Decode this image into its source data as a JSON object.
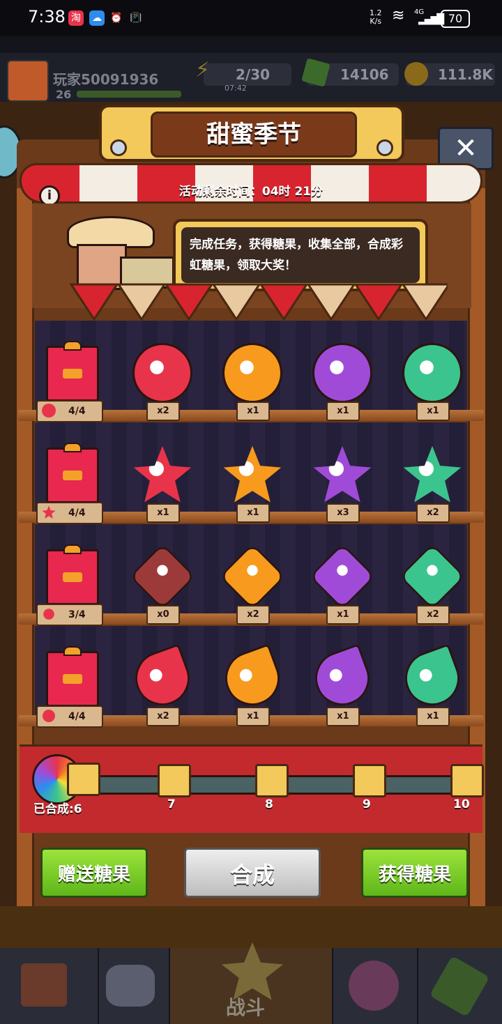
{
  "status_bar": {
    "time": "7:38",
    "app_icons": [
      "taobao-icon",
      "cloud-icon",
      "alarm-icon",
      "vibrate-icon"
    ],
    "net_speed_value": "1.2",
    "net_speed_unit": "K/s",
    "network_type": "4G",
    "battery": "70"
  },
  "game_header": {
    "player_name": "玩家50091936",
    "level": "26",
    "energy": "2/30",
    "energy_timer": "07:42",
    "gems": "14106",
    "coins": "111.8K"
  },
  "event": {
    "title": "甜蜜季节",
    "time_left": "活动剩余时间：04时 21分",
    "description": "完成任务，获得糖果，收集全部，合成彩虹糖果，领取大奖！"
  },
  "shelves": [
    {
      "shape": "round",
      "progress": "4/4",
      "candies": [
        {
          "color": "#e8344a",
          "count": "x2"
        },
        {
          "color": "#f79a1e",
          "count": "x1"
        },
        {
          "color": "#a04bd8",
          "count": "x1"
        },
        {
          "color": "#3cc48e",
          "count": "x1"
        }
      ]
    },
    {
      "shape": "star",
      "progress": "4/4",
      "candies": [
        {
          "color": "#e8344a",
          "count": "x1"
        },
        {
          "color": "#f79a1e",
          "count": "x1"
        },
        {
          "color": "#a04bd8",
          "count": "x3"
        },
        {
          "color": "#3cc48e",
          "count": "x2"
        }
      ]
    },
    {
      "shape": "diamond",
      "progress": "3/4",
      "candies": [
        {
          "color": "#9c3a3a",
          "count": "x0"
        },
        {
          "color": "#f79a1e",
          "count": "x2"
        },
        {
          "color": "#a04bd8",
          "count": "x1"
        },
        {
          "color": "#3cc48e",
          "count": "x2"
        }
      ]
    },
    {
      "shape": "fan",
      "progress": "4/4",
      "candies": [
        {
          "color": "#e8344a",
          "count": "x2"
        },
        {
          "color": "#f79a1e",
          "count": "x1"
        },
        {
          "color": "#a04bd8",
          "count": "x1"
        },
        {
          "color": "#3cc48e",
          "count": "x1"
        }
      ]
    }
  ],
  "synth_track": {
    "done_label": "已合成:6",
    "milestones": [
      "7",
      "8",
      "9",
      "10"
    ]
  },
  "buttons": {
    "gift": "赠送糖果",
    "synth": "合成",
    "get": "获得糖果"
  },
  "nav": {
    "battle": "战斗"
  },
  "colors": {
    "green_button": "#7ad11f",
    "gray_button": "#d7d7d7",
    "awning_red": "#d8242f",
    "panel_wood": "#6a3a1b"
  }
}
